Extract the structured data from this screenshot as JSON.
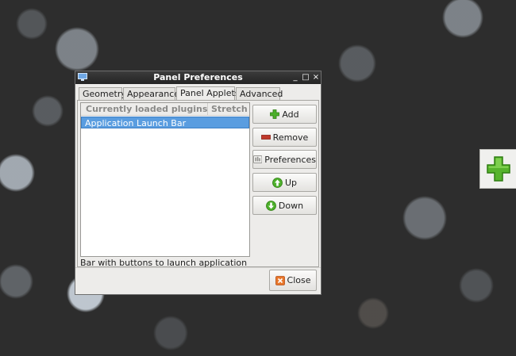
{
  "window": {
    "title": "Panel Preferences",
    "controls": {
      "minimize": "_",
      "maximize": "□",
      "close": "×"
    }
  },
  "tabs": [
    {
      "label": "Geometry",
      "active": false
    },
    {
      "label": "Appearance",
      "active": false
    },
    {
      "label": "Panel Applets",
      "active": true
    },
    {
      "label": "Advanced",
      "active": false
    }
  ],
  "plugins": {
    "columns": [
      "Currently loaded plugins",
      "Stretch"
    ],
    "rows": [
      {
        "name": "Application Launch Bar",
        "selected": true
      }
    ]
  },
  "buttons": {
    "add": "Add",
    "remove": "Remove",
    "preferences": "Preferences",
    "up": "Up",
    "down": "Down",
    "close": "Close"
  },
  "description": "Bar with buttons to launch application",
  "colors": {
    "selection": "#5a9de0",
    "titlebar": "#2a2a2a",
    "add_icon": "#4caf2a",
    "remove_icon": "#c0392b",
    "close_icon": "#e8762a"
  }
}
